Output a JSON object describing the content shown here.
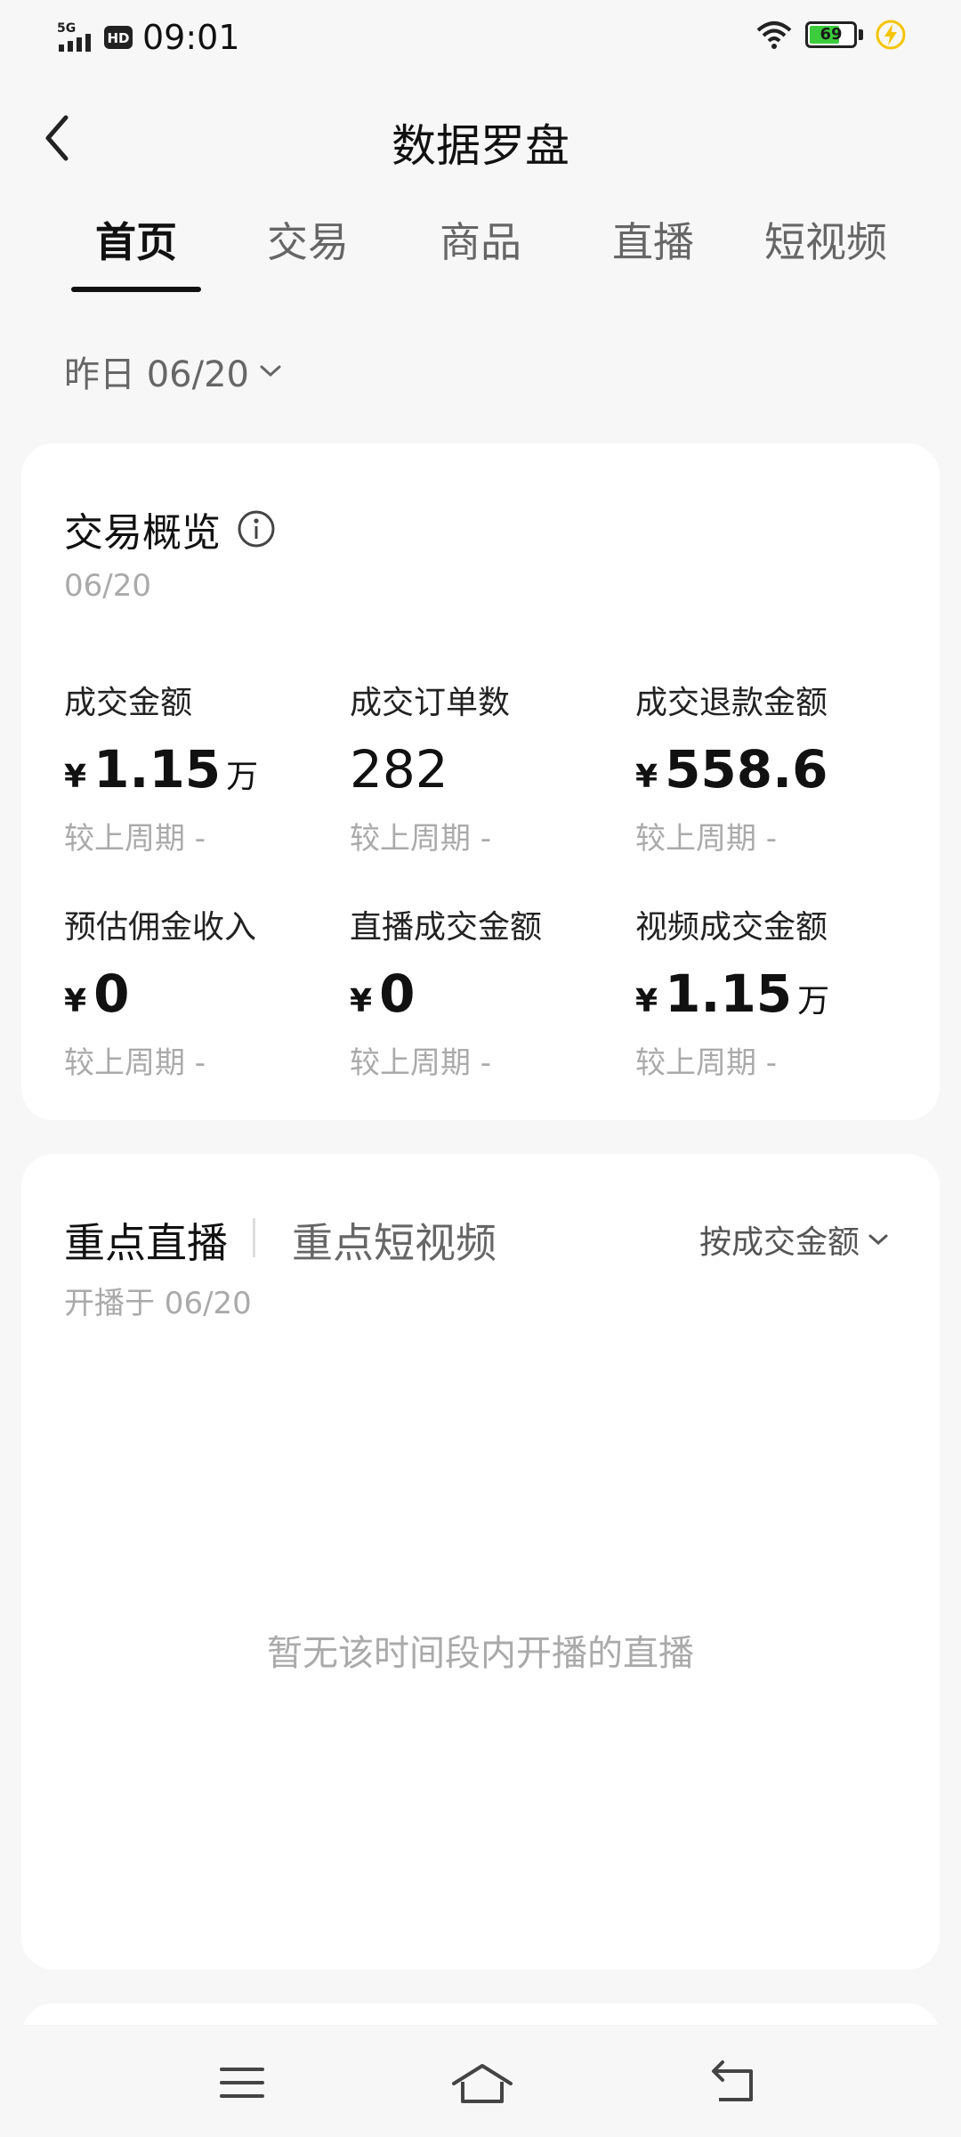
{
  "status_bar": {
    "network": "5G",
    "hd": "HD",
    "time": "09:01",
    "battery": "69",
    "battery_level": 0.69
  },
  "header": {
    "title": "数据罗盘"
  },
  "tabs": [
    {
      "label": "首页",
      "active": true
    },
    {
      "label": "交易",
      "active": false
    },
    {
      "label": "商品",
      "active": false
    },
    {
      "label": "直播",
      "active": false
    },
    {
      "label": "短视频",
      "active": false
    }
  ],
  "date_selector": {
    "label": "昨日 06/20"
  },
  "overview": {
    "title": "交易概览",
    "date": "06/20",
    "metrics": [
      {
        "label": "成交金额",
        "currency": "¥",
        "value": "1.15",
        "unit": "万",
        "compare": "较上周期 -"
      },
      {
        "label": "成交订单数",
        "currency": "",
        "value": "282",
        "unit": "",
        "compare": "较上周期 -"
      },
      {
        "label": "成交退款金额",
        "currency": "¥",
        "value": "558.6",
        "unit": "",
        "compare": "较上周期 -"
      },
      {
        "label": "预估佣金收入",
        "currency": "¥",
        "value": "0",
        "unit": "",
        "compare": "较上周期 -"
      },
      {
        "label": "直播成交金额",
        "currency": "¥",
        "value": "0",
        "unit": "",
        "compare": "较上周期 -"
      },
      {
        "label": "视频成交金额",
        "currency": "¥",
        "value": "1.15",
        "unit": "万",
        "compare": "较上周期 -"
      }
    ]
  },
  "focus": {
    "tab_live": "重点直播",
    "tab_video": "重点短视频",
    "sort_label": "按成交金额",
    "subtitle": "开播于 06/20",
    "empty_text": "暂无该时间段内开播的直播"
  }
}
